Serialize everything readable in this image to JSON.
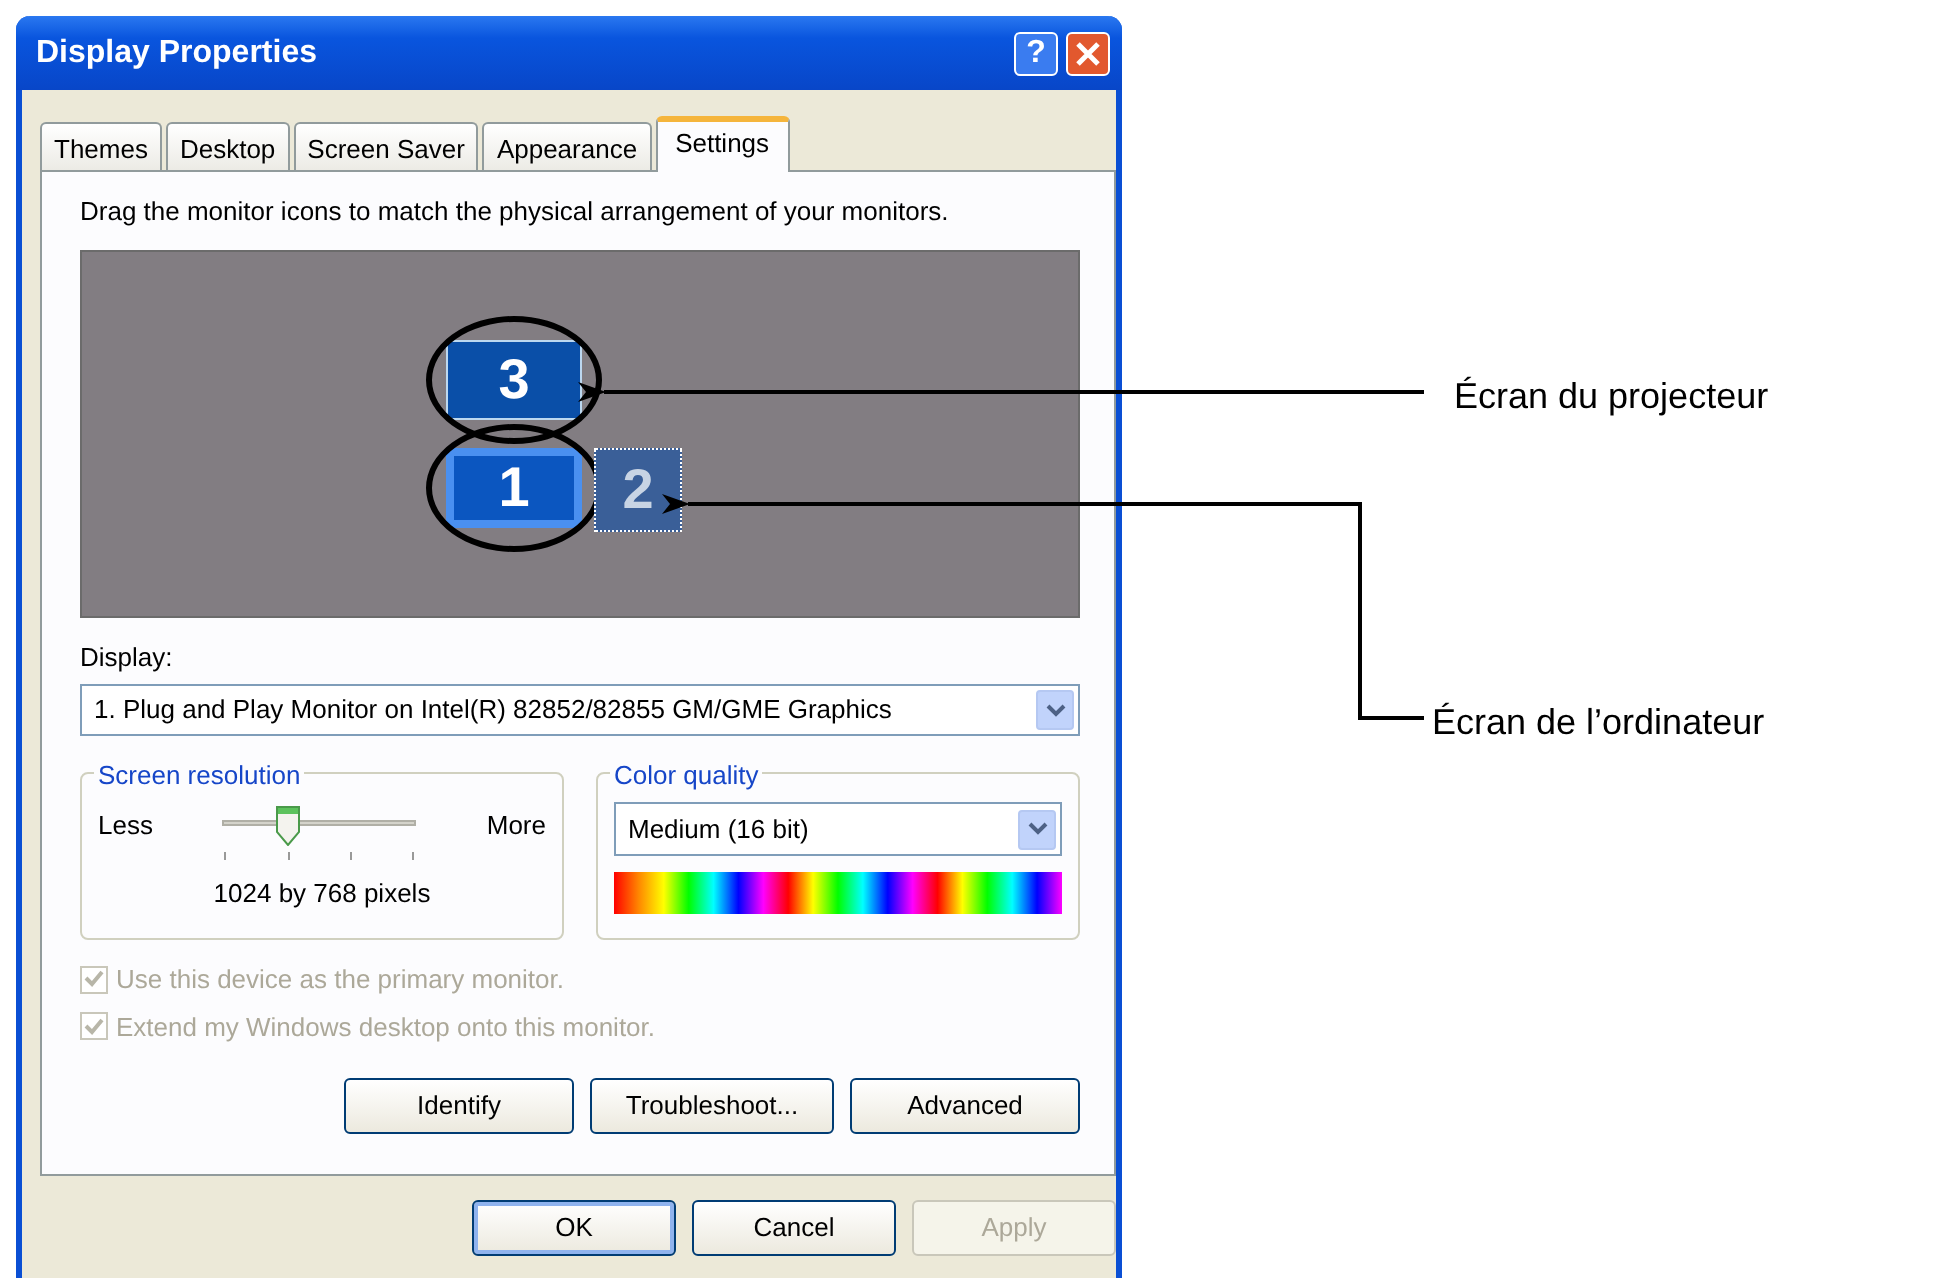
{
  "window": {
    "title": "Display Properties",
    "help": "?"
  },
  "tabs": [
    {
      "label": "Themes",
      "selected": false
    },
    {
      "label": "Desktop",
      "selected": false
    },
    {
      "label": "Screen Saver",
      "selected": false
    },
    {
      "label": "Appearance",
      "selected": false
    },
    {
      "label": "Settings",
      "selected": true
    }
  ],
  "instruction": "Drag the monitor icons to match the physical arrangement of your monitors.",
  "monitors": [
    {
      "number": "3",
      "selected": false,
      "attached": true,
      "circled": true
    },
    {
      "number": "1",
      "selected": true,
      "attached": true,
      "circled": true
    },
    {
      "number": "2",
      "selected": false,
      "attached": false,
      "circled": false
    }
  ],
  "display": {
    "label": "Display:",
    "value": "1. Plug and Play Monitor on Intel(R) 82852/82855 GM/GME Graphics"
  },
  "screen_resolution": {
    "title": "Screen resolution",
    "less": "Less",
    "more": "More",
    "level": 0.33,
    "reading": "1024 by 768 pixels"
  },
  "color_quality": {
    "title": "Color quality",
    "value": "Medium (16 bit)"
  },
  "checkboxes": [
    {
      "label": "Use this device as the primary monitor.",
      "checked": true,
      "disabled": true
    },
    {
      "label": "Extend my Windows desktop onto this monitor.",
      "checked": true,
      "disabled": true
    }
  ],
  "panel_buttons": [
    {
      "label": "Identify",
      "disabled": false
    },
    {
      "label": "Troubleshoot...",
      "disabled": false
    },
    {
      "label": "Advanced",
      "disabled": false
    }
  ],
  "dialog_buttons": [
    {
      "label": "OK",
      "default": true,
      "disabled": false
    },
    {
      "label": "Cancel",
      "default": false,
      "disabled": false
    },
    {
      "label": "Apply",
      "default": false,
      "disabled": true
    }
  ],
  "annotations": [
    {
      "text": "Écran du projecteur"
    },
    {
      "text": "Écran de l’ordinateur"
    }
  ]
}
